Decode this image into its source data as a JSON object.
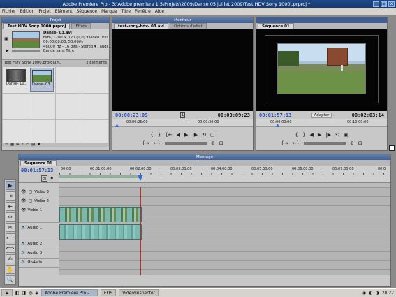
{
  "app": {
    "title": "Adobe Premiere Pro - 3:\\Adobe premiere 1.5\\Projets\\2009\\Danse 05 juillet 2009\\Test HDV Sony 1000\\.prproj *",
    "minimize": "_",
    "maximize": "□",
    "close": "x"
  },
  "menu": [
    "Fichier",
    "Edition",
    "Projet",
    "Elément",
    "Séquence",
    "Marque",
    "Titre",
    "Fenêtre",
    "Aide"
  ],
  "project": {
    "header": "Projet",
    "tabs": [
      "Test HDV Sony 1000.prproj",
      "Effets"
    ],
    "clip_name": "Danse- 03.avi",
    "clip_info": [
      "Film, 1280 × 720 (1,0)  ▾  vidéo utili...",
      "00:00:08:03, 50,00i/s",
      "48000 Hz - 16 bits - Stéréo  ▾  , audi...",
      "Bande sans Titre"
    ],
    "path": "Test HDV Sony 1000.prproj\\JYC",
    "count": "2 Eléments",
    "thumbs": [
      "Danse- 10...",
      "Danse- 03..."
    ]
  },
  "source": {
    "header": "Moniteur",
    "tabs": [
      "test-sony-hdv- 03.avi",
      "Options d'effet"
    ],
    "tc_in": "00:00:23:09",
    "tc_out": "00:00:09:23",
    "ruler": [
      "00:00:25:00",
      "00:00:30:00"
    ],
    "ctl_row1": [
      "{",
      "}",
      "{←",
      "◀|",
      "◀",
      "▶",
      "|▶",
      "▶|",
      "→}"
    ],
    "ctl_row2": [
      "{→",
      "←}",
      "⊕",
      "⊞"
    ]
  },
  "program": {
    "tabs": [
      "Séquence 01"
    ],
    "tc_in": "00:01:57:13",
    "fit": "Adapter",
    "tc_out": "00:02:03:14",
    "ruler": [
      "00:00:00:00",
      "00:10:00:00"
    ]
  },
  "timeline": {
    "header": "Montage",
    "tab": "Séquence 01",
    "tc": "00:01:57:13",
    "ruler": [
      "00:00",
      "00:01:00:00",
      "00:02:00:00",
      "00:03:00:00",
      "00:04:00:00",
      "00:05:00:00",
      "00:06:00:00",
      "00:07:00:00",
      "00:0"
    ],
    "tracks": [
      {
        "name": "Vidéo 3",
        "kind": "video"
      },
      {
        "name": "Vidéo 2",
        "kind": "video"
      },
      {
        "name": "Vidéo 1",
        "kind": "video"
      },
      {
        "name": "Audio 1",
        "kind": "audio"
      },
      {
        "name": "Audio 2",
        "kind": "audio"
      },
      {
        "name": "Audio 3",
        "kind": "audio"
      },
      {
        "name": "Globale",
        "kind": "master"
      }
    ],
    "tools": [
      "▶",
      "⇥",
      "⇤",
      "⇹",
      "✂",
      "⟷",
      "⟺",
      "✍",
      "✋",
      "🔍"
    ]
  },
  "taskbar": {
    "items": [
      "Adobe Premiere Pro - ...",
      "EOS",
      "Vidéo\\Inspector"
    ],
    "clock": "20:22"
  },
  "colors": {
    "accent": "#1a4fc4",
    "playhead": "#e02020",
    "clip": "#7ab8b0"
  }
}
